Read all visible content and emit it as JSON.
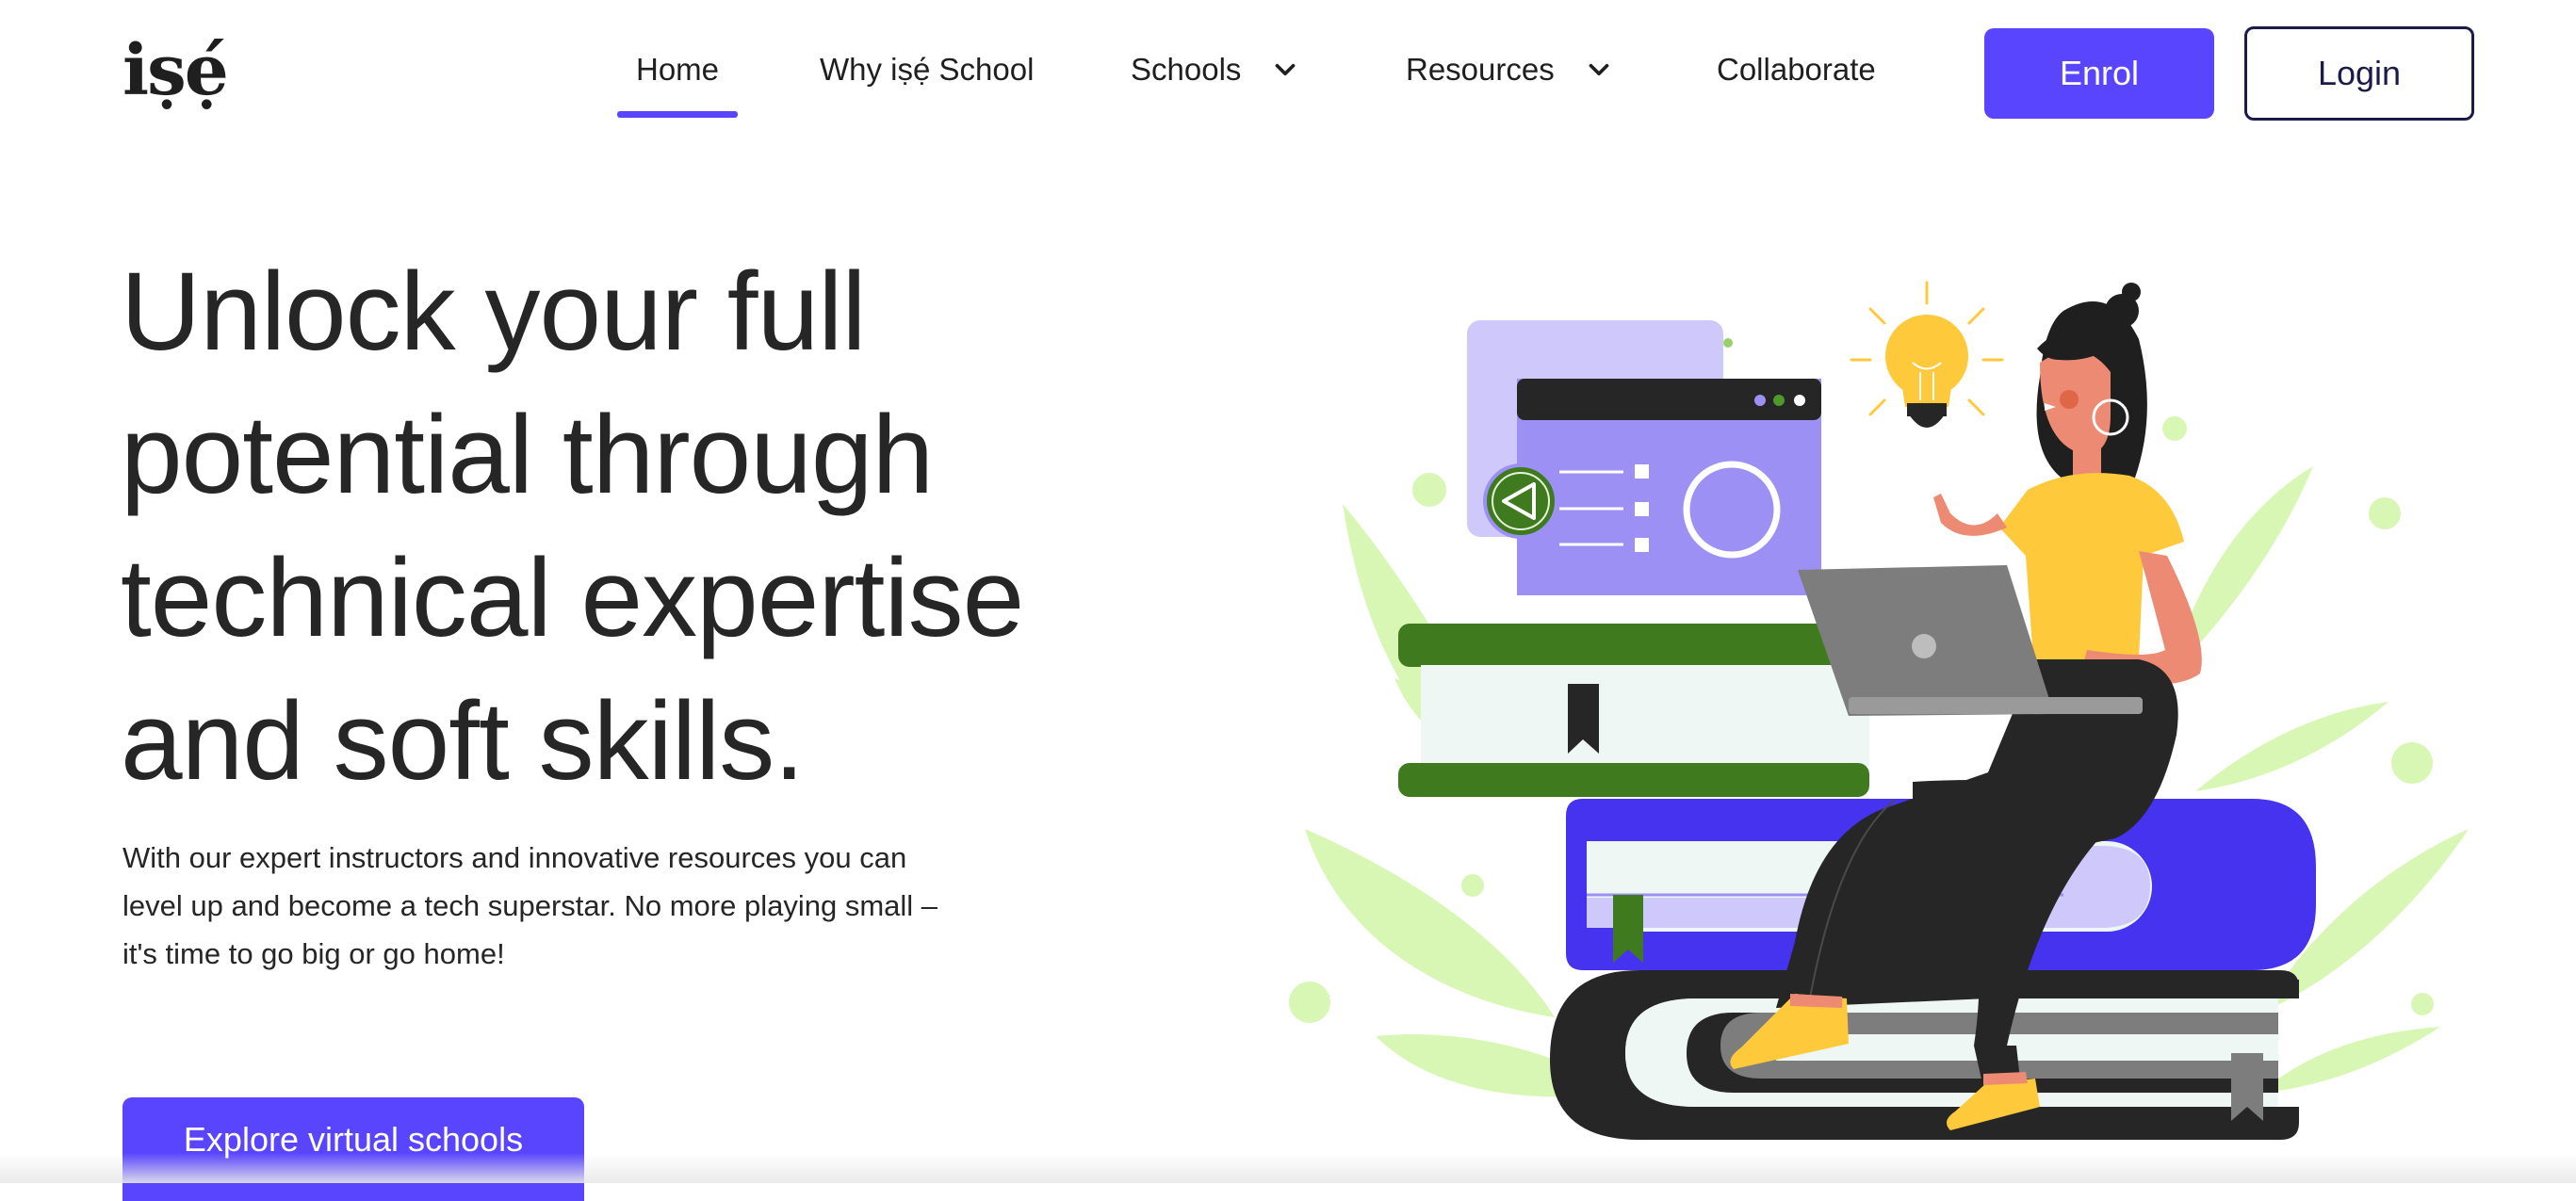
{
  "header": {
    "logo_text": "iṣẹ́",
    "nav": [
      {
        "label": "Home",
        "active": true
      },
      {
        "label": "Why iṣẹ́ School",
        "active": false
      },
      {
        "label": "Schools",
        "has_dropdown": true,
        "icon": "chevron-down-icon"
      },
      {
        "label": "Resources",
        "has_dropdown": true,
        "icon": "chevron-down-icon"
      },
      {
        "label": "Collaborate",
        "active": false
      }
    ],
    "enrol_label": "Enrol",
    "login_label": "Login"
  },
  "hero": {
    "title": "Unlock your full potential through technical expertise and soft skills.",
    "subtitle": "With our expert instructors and innovative resources you can level up and become a tech superstar. No more playing small – it's time to go big or go home!",
    "cta_label": "Explore virtual schools"
  },
  "illustration": {
    "subject": "woman-with-laptop-on-books",
    "icons": [
      "lightbulb-icon",
      "play-back-icon",
      "bookmark-icon",
      "laptop-icon"
    ]
  },
  "colors": {
    "accent": "#5a45ff",
    "text": "#262626",
    "login_border": "#1b1b4a",
    "leaf_green": "#d8f7b5",
    "book_green": "#3f7a1f",
    "lavender": "#9d90f5",
    "yellow": "#ffc93c"
  }
}
